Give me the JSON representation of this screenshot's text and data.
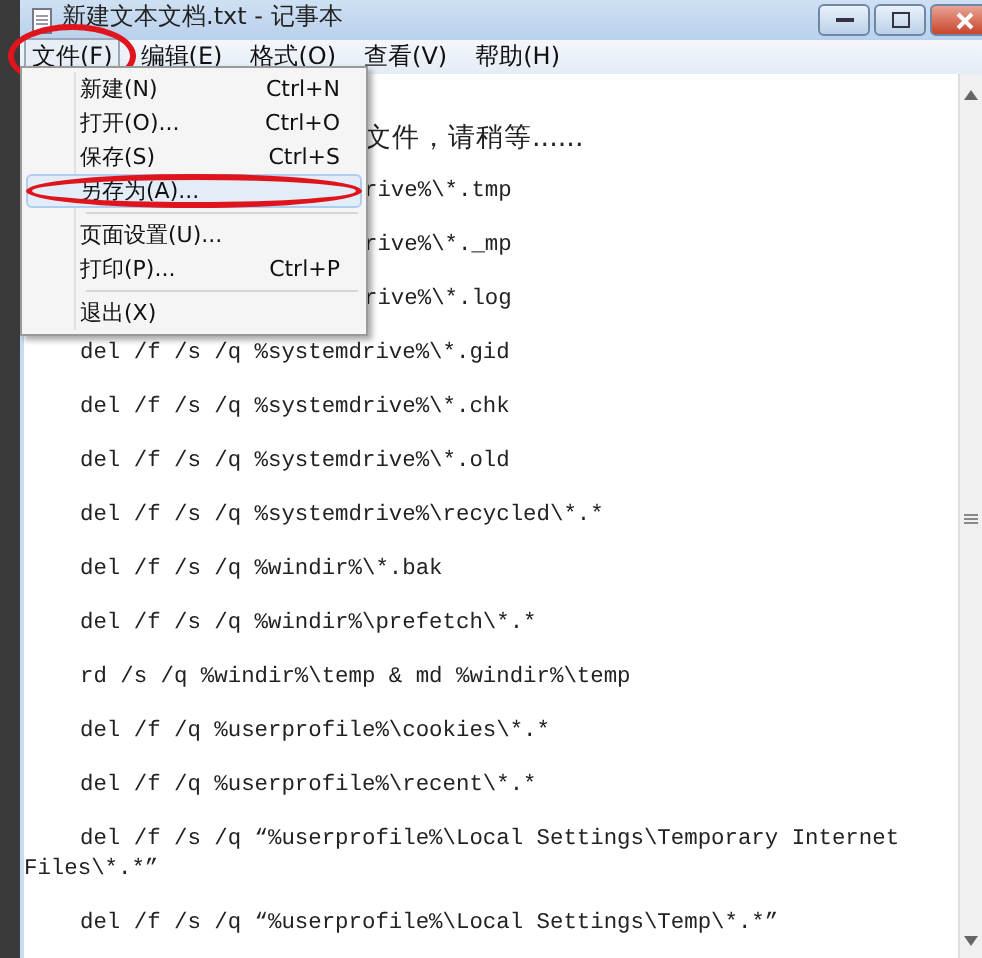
{
  "window": {
    "title": "新建文本文档.txt - 记事本"
  },
  "menu_bar": [
    {
      "label": "文件(F)",
      "selected": true,
      "circled": true
    },
    {
      "label": "编辑(E)",
      "selected": false,
      "circled": false
    },
    {
      "label": "格式(O)",
      "selected": false,
      "circled": false
    },
    {
      "label": "查看(V)",
      "selected": false,
      "circled": false
    },
    {
      "label": "帮助(H)",
      "selected": false,
      "circled": false
    }
  ],
  "file_menu": [
    {
      "kind": "item",
      "label": "新建(N)",
      "shortcut": "Ctrl+N",
      "selected": false,
      "circled": false
    },
    {
      "kind": "item",
      "label": "打开(O)...",
      "shortcut": "Ctrl+O",
      "selected": false,
      "circled": false
    },
    {
      "kind": "item",
      "label": "保存(S)",
      "shortcut": "Ctrl+S",
      "selected": false,
      "circled": false
    },
    {
      "kind": "item",
      "label": "另存为(A)...",
      "selected": true,
      "circled": true
    },
    {
      "kind": "separator"
    },
    {
      "kind": "item",
      "label": "页面设置(U)...",
      "selected": false,
      "circled": false
    },
    {
      "kind": "item",
      "label": "打印(P)...",
      "shortcut": "Ctrl+P",
      "selected": false,
      "circled": false
    },
    {
      "kind": "separator"
    },
    {
      "kind": "item",
      "label": "退出(X)",
      "selected": false,
      "circled": false
    }
  ],
  "editor_lines": [
    {
      "kind": "partial",
      "text": "文件，请稍等......"
    },
    {
      "kind": "partial",
      "text": "rive%\\*.tmp"
    },
    {
      "kind": "partial",
      "text": "rive%\\*._mp"
    },
    {
      "kind": "partial",
      "text": "rive%\\*.log"
    },
    {
      "kind": "full",
      "text": "del /f /s /q %systemdrive%\\*.gid"
    },
    {
      "kind": "full",
      "text": "del /f /s /q %systemdrive%\\*.chk"
    },
    {
      "kind": "full",
      "text": "del /f /s /q %systemdrive%\\*.old"
    },
    {
      "kind": "full",
      "text": "del /f /s /q %systemdrive%\\recycled\\*.*"
    },
    {
      "kind": "full",
      "text": "del /f /s /q %windir%\\*.bak"
    },
    {
      "kind": "full",
      "text": "del /f /s /q %windir%\\prefetch\\*.*"
    },
    {
      "kind": "full",
      "text": "rd /s /q %windir%\\temp & md %windir%\\temp"
    },
    {
      "kind": "full",
      "text": "del /f /q %userprofile%\\cookies\\*.*"
    },
    {
      "kind": "full",
      "text": "del /f /q %userprofile%\\recent\\*.*"
    },
    {
      "kind": "full",
      "text": "del /f /s /q “%userprofile%\\Local Settings\\Temporary Internet Files\\*.*”"
    },
    {
      "kind": "full",
      "text": "del /f /s /q “%userprofile%\\Local Settings\\Temp\\*.*”"
    }
  ]
}
